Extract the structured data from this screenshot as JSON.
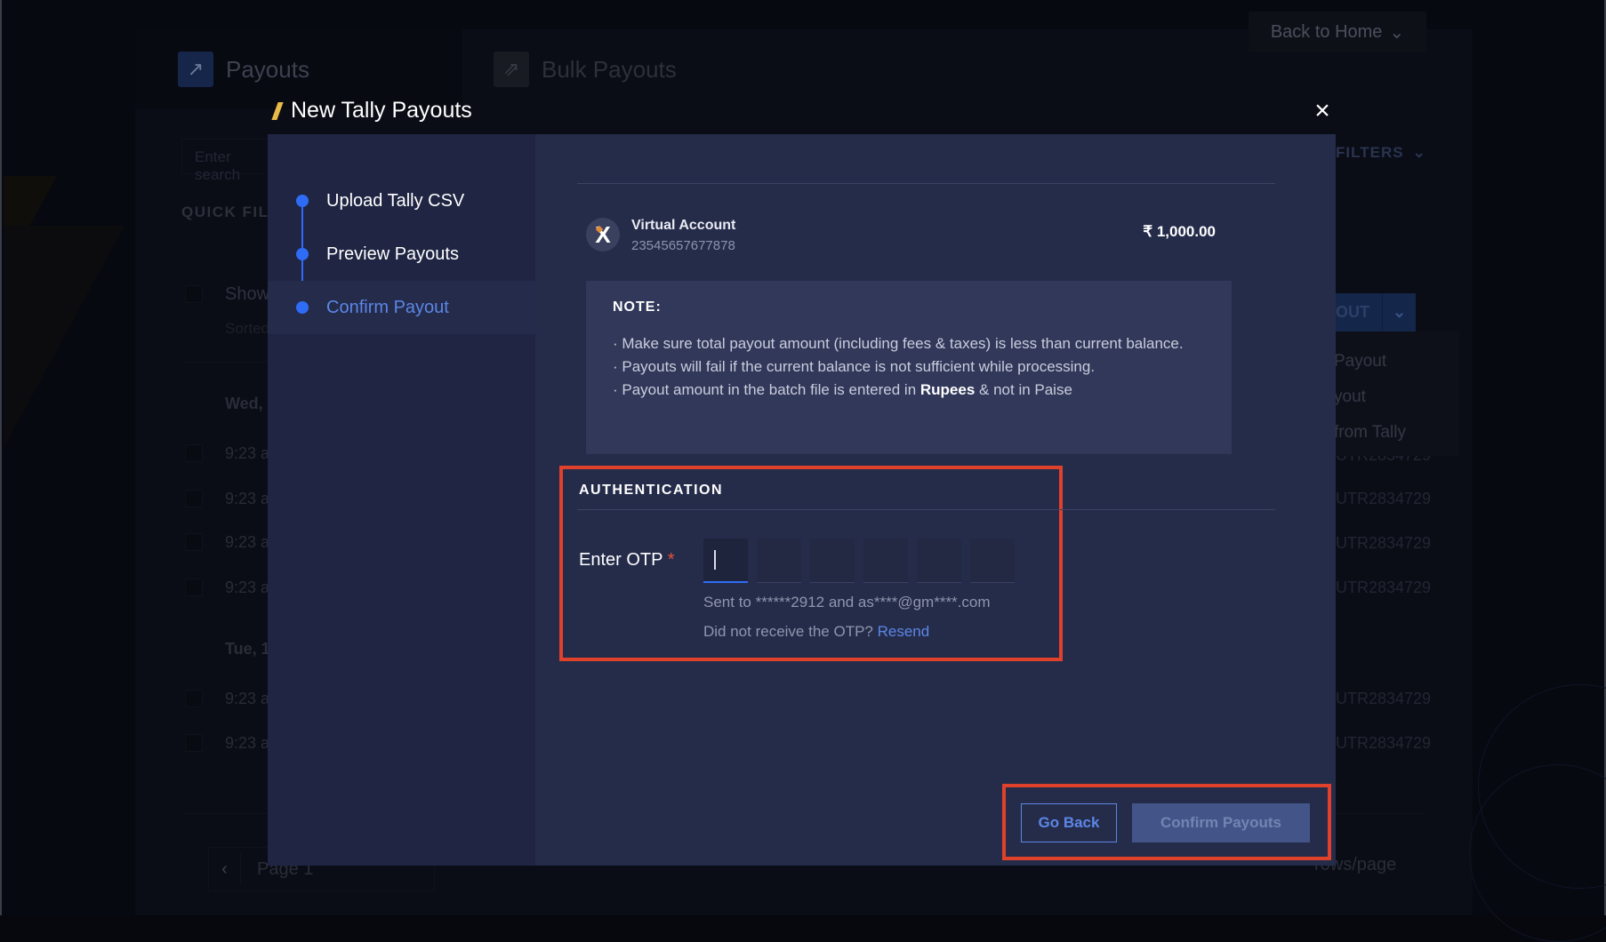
{
  "background": {
    "tabs": [
      {
        "label": "Payouts",
        "icon": "arrow-up-right-icon"
      },
      {
        "label": "Bulk Payouts",
        "icon": "double-arrow-up-right-icon"
      }
    ],
    "back_to_home": "Back to Home",
    "search_placeholder": "Enter search",
    "filters_label": "FILTERS",
    "quick_filters_label": "QUICK FILTERS",
    "show_label": "Show",
    "sorted_label": "Sorted",
    "add_payout_label": "OUT",
    "add_menu": [
      "Payout",
      "yout",
      "from Tally"
    ],
    "groups": [
      {
        "date": "Wed,",
        "rows": [
          "9:23 a",
          "9:23 a",
          "9:23 a",
          "9:23 a"
        ]
      },
      {
        "date": "Tue, 1",
        "rows": [
          "9:23 a",
          "9:23 a"
        ]
      }
    ],
    "utr_values": [
      "UTR2834729",
      "UTR2834729",
      "UTR2834729",
      "UTR2834729",
      "UTR2834729",
      "UTR2834729"
    ],
    "pagination": {
      "prev": "‹",
      "page_label": "Page 1",
      "rows_label": "rows/page"
    }
  },
  "modal": {
    "title": "New Tally Payouts",
    "close_icon": "×",
    "steps": [
      {
        "label": "Upload Tally CSV",
        "state": "done"
      },
      {
        "label": "Preview Payouts",
        "state": "done"
      },
      {
        "label": "Confirm Payout",
        "state": "active"
      }
    ],
    "account": {
      "logo_letter": "X",
      "name": "Virtual Account",
      "number": "23545657677878",
      "amount": "₹ 1,000.00"
    },
    "note": {
      "title": "NOTE:",
      "line1": "· Make sure total payout amount (including fees & taxes) is less than current balance.",
      "line2": "· Payouts will fail if the current balance is not sufficient while processing.",
      "line3_before": "· Payout amount in the batch file is entered in ",
      "line3_bold": "Rupees",
      "line3_after": " & not in Paise"
    },
    "authentication": {
      "title": "AUTHENTICATION",
      "otp_label": "Enter OTP",
      "required_mark": "*",
      "otp_digits": [
        "",
        "",
        "",
        "",
        "",
        ""
      ],
      "sent_to": "Sent to ******2912 and as****@gm****.com",
      "resend_prompt": "Did not receive the OTP? ",
      "resend_link": "Resend"
    },
    "buttons": {
      "go_back": "Go Back",
      "confirm": "Confirm Payouts"
    }
  },
  "colors": {
    "accent_blue": "#2f6cf6",
    "link_blue": "#5c86e6",
    "highlight_red": "#e0412a",
    "title_mark_yellow": "#e9b949"
  }
}
